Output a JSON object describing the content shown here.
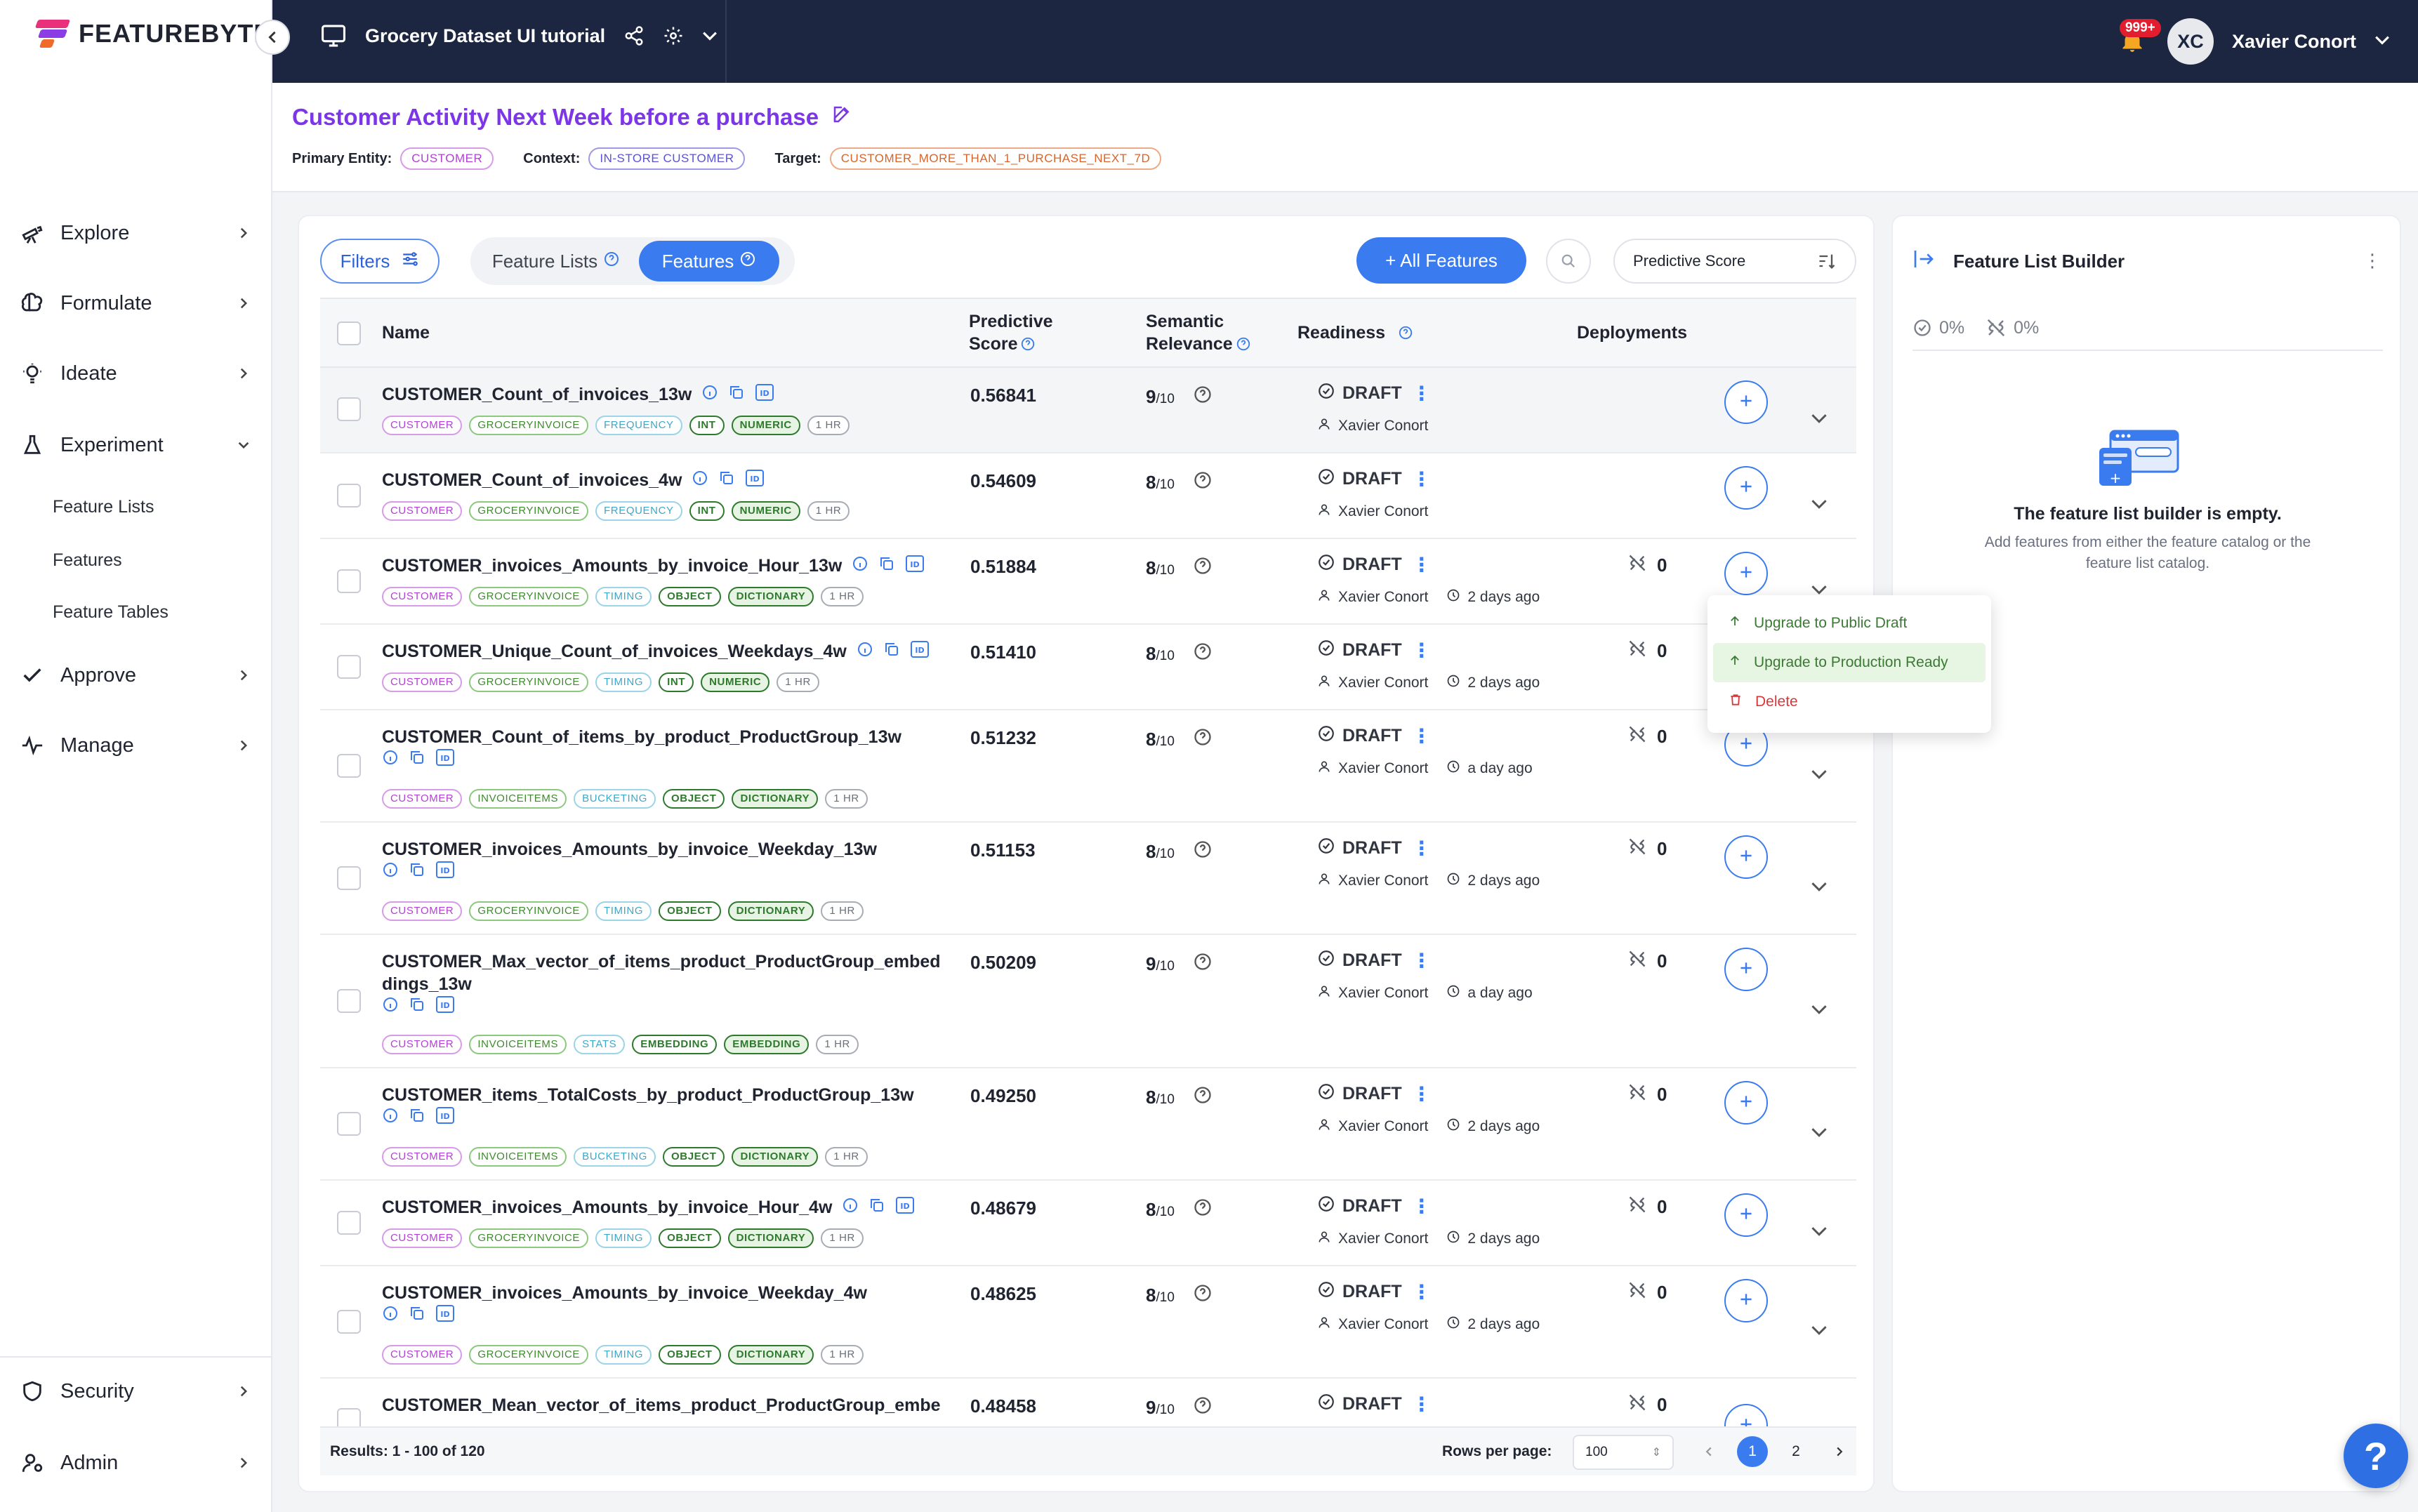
{
  "app": {
    "logo_text": "FEATUREBYTE"
  },
  "topbar": {
    "project_name": "Grocery Dataset UI tutorial",
    "notif_count": "999+",
    "avatar_initials": "XC",
    "user_name": "Xavier Conort"
  },
  "sidebar": {
    "items": [
      {
        "label": "Explore"
      },
      {
        "label": "Formulate"
      },
      {
        "label": "Ideate"
      },
      {
        "label": "Experiment"
      },
      {
        "label": "Approve"
      },
      {
        "label": "Manage"
      }
    ],
    "experiment_sub": [
      {
        "label": "Feature Lists"
      },
      {
        "label": "Features"
      },
      {
        "label": "Feature Tables"
      }
    ],
    "bottom": [
      {
        "label": "Security"
      },
      {
        "label": "Admin"
      }
    ]
  },
  "page": {
    "title": "Customer Activity Next Week before a purchase",
    "primary_entity_label": "Primary Entity:",
    "primary_entity": "CUSTOMER",
    "context_label": "Context:",
    "context": "IN-STORE CUSTOMER",
    "target_label": "Target:",
    "target": "CUSTOMER_MORE_THAN_1_PURCHASE_NEXT_7D"
  },
  "toolbar": {
    "filters": "Filters",
    "feature_lists": "Feature Lists",
    "features": "Features",
    "all_features": "+ All Features",
    "sort_value": "Predictive Score"
  },
  "table": {
    "col_name": "Name",
    "col_score_1": "Predictive",
    "col_score_2": "Score",
    "col_sem_1": "Semantic",
    "col_sem_2": "Relevance",
    "col_readiness": "Readiness",
    "col_deployments": "Deployments"
  },
  "rows": [
    {
      "name": "CUSTOMER_Count_of_invoices_13w",
      "score": "0.56841",
      "sem": "9",
      "readiness": "DRAFT",
      "owner": "Xavier Conort",
      "age": "",
      "deploy": "",
      "tags": [
        "CUSTOMER",
        "GROCERYINVOICE",
        "FREQUENCY",
        "INT",
        "NUMERIC",
        "1 HR"
      ]
    },
    {
      "name": "CUSTOMER_Count_of_invoices_4w",
      "score": "0.54609",
      "sem": "8",
      "readiness": "DRAFT",
      "owner": "Xavier Conort",
      "age": "",
      "deploy": "",
      "tags": [
        "CUSTOMER",
        "GROCERYINVOICE",
        "FREQUENCY",
        "INT",
        "NUMERIC",
        "1 HR"
      ]
    },
    {
      "name": "CUSTOMER_invoices_Amounts_by_invoice_Hour_13w",
      "score": "0.51884",
      "sem": "8",
      "readiness": "DRAFT",
      "owner": "Xavier Conort",
      "age": "2 days ago",
      "deploy": "0",
      "tags": [
        "CUSTOMER",
        "GROCERYINVOICE",
        "TIMING",
        "OBJECT",
        "DICTIONARY",
        "1 HR"
      ]
    },
    {
      "name": "CUSTOMER_Unique_Count_of_invoices_Weekdays_4w",
      "score": "0.51410",
      "sem": "8",
      "readiness": "DRAFT",
      "owner": "Xavier Conort",
      "age": "2 days ago",
      "deploy": "0",
      "tags": [
        "CUSTOMER",
        "GROCERYINVOICE",
        "TIMING",
        "INT",
        "NUMERIC",
        "1 HR"
      ]
    },
    {
      "name": "CUSTOMER_Count_of_items_by_product_ProductGroup_13w",
      "score": "0.51232",
      "sem": "8",
      "readiness": "DRAFT",
      "owner": "Xavier Conort",
      "age": "a day ago",
      "deploy": "0",
      "tags": [
        "CUSTOMER",
        "INVOICEITEMS",
        "BUCKETING",
        "OBJECT",
        "DICTIONARY",
        "1 HR"
      ]
    },
    {
      "name": "CUSTOMER_invoices_Amounts_by_invoice_Weekday_13w",
      "score": "0.51153",
      "sem": "8",
      "readiness": "DRAFT",
      "owner": "Xavier Conort",
      "age": "2 days ago",
      "deploy": "0",
      "tags": [
        "CUSTOMER",
        "GROCERYINVOICE",
        "TIMING",
        "OBJECT",
        "DICTIONARY",
        "1 HR"
      ]
    },
    {
      "name": "CUSTOMER_Max_vector_of_items_product_ProductGroup_embeddings_13w",
      "score": "0.50209",
      "sem": "9",
      "readiness": "DRAFT",
      "owner": "Xavier Conort",
      "age": "a day ago",
      "deploy": "0",
      "tags": [
        "CUSTOMER",
        "INVOICEITEMS",
        "STATS",
        "EMBEDDING",
        "EMBEDDING",
        "1 HR"
      ]
    },
    {
      "name": "CUSTOMER_items_TotalCosts_by_product_ProductGroup_13w",
      "score": "0.49250",
      "sem": "8",
      "readiness": "DRAFT",
      "owner": "Xavier Conort",
      "age": "2 days ago",
      "deploy": "0",
      "tags": [
        "CUSTOMER",
        "INVOICEITEMS",
        "BUCKETING",
        "OBJECT",
        "DICTIONARY",
        "1 HR"
      ]
    },
    {
      "name": "CUSTOMER_invoices_Amounts_by_invoice_Hour_4w",
      "score": "0.48679",
      "sem": "8",
      "readiness": "DRAFT",
      "owner": "Xavier Conort",
      "age": "2 days ago",
      "deploy": "0",
      "tags": [
        "CUSTOMER",
        "GROCERYINVOICE",
        "TIMING",
        "OBJECT",
        "DICTIONARY",
        "1 HR"
      ]
    },
    {
      "name": "CUSTOMER_invoices_Amounts_by_invoice_Weekday_4w",
      "score": "0.48625",
      "sem": "8",
      "readiness": "DRAFT",
      "owner": "Xavier Conort",
      "age": "2 days ago",
      "deploy": "0",
      "tags": [
        "CUSTOMER",
        "GROCERYINVOICE",
        "TIMING",
        "OBJECT",
        "DICTIONARY",
        "1 HR"
      ]
    },
    {
      "name": "CUSTOMER_Mean_vector_of_items_product_ProductGroup_embe",
      "score": "0.48458",
      "sem": "9",
      "readiness": "DRAFT",
      "owner": "",
      "age": "",
      "deploy": "0",
      "tags": []
    }
  ],
  "sem_den": "/10",
  "menu": {
    "upgrade_public": "Upgrade to Public Draft",
    "upgrade_prod": "Upgrade to Production Ready",
    "delete": "Delete"
  },
  "footer": {
    "results": "Results: 1 - 100 of 120",
    "rows_per_page": "Rows per page:",
    "rpp_value": "100",
    "pages": [
      "1",
      "2"
    ]
  },
  "builder": {
    "title": "Feature List Builder",
    "stat_readiness": "0%",
    "stat_online": "0%",
    "empty_title": "The feature list builder is empty.",
    "empty_sub": "Add features from either the feature catalog or the feature list catalog."
  },
  "help": "?",
  "colors": {
    "accent": "#3a7cf0",
    "title_purple": "#7c35e8",
    "topbar": "#1c2640",
    "customer_tag": "#b43fd6",
    "context_tag": "#5b52d6",
    "target_tag": "#d9642a"
  }
}
